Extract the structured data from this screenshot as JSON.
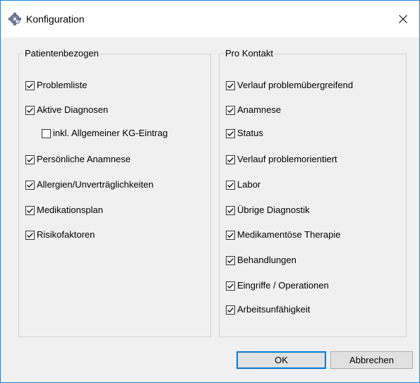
{
  "window": {
    "title": "Konfiguration",
    "icon": "gear-icon",
    "accent_color": "#0078d7"
  },
  "left_group": {
    "title": "Patientenbezogen",
    "items": [
      {
        "label": "Problemliste",
        "checked": true
      },
      {
        "label": "Aktive Diagnosen",
        "checked": true
      },
      {
        "label": "inkl. Allgemeiner KG-Eintrag",
        "checked": false
      },
      {
        "label": "Persönliche Anamnese",
        "checked": true
      },
      {
        "label": "Allergien/Unverträglichkeiten",
        "checked": true
      },
      {
        "label": "Medikationsplan",
        "checked": true
      },
      {
        "label": "Risikofaktoren",
        "checked": true
      }
    ]
  },
  "right_group": {
    "title": "Pro Kontakt",
    "items": [
      {
        "label": "Verlauf problemübergreifend",
        "checked": true
      },
      {
        "label": "Anamnese",
        "checked": true
      },
      {
        "label": "Status",
        "checked": true
      },
      {
        "label": "Verlauf problemorientiert",
        "checked": true
      },
      {
        "label": "Labor",
        "checked": true
      },
      {
        "label": "Übrige Diagnostik",
        "checked": true
      },
      {
        "label": "Medikamentöse Therapie",
        "checked": true
      },
      {
        "label": "Behandlungen",
        "checked": true
      },
      {
        "label": "Eingriffe / Operationen",
        "checked": true
      },
      {
        "label": "Arbeitsunfähigkeit",
        "checked": true
      }
    ]
  },
  "buttons": {
    "ok_label": "OK",
    "cancel_label": "Abbrechen"
  }
}
